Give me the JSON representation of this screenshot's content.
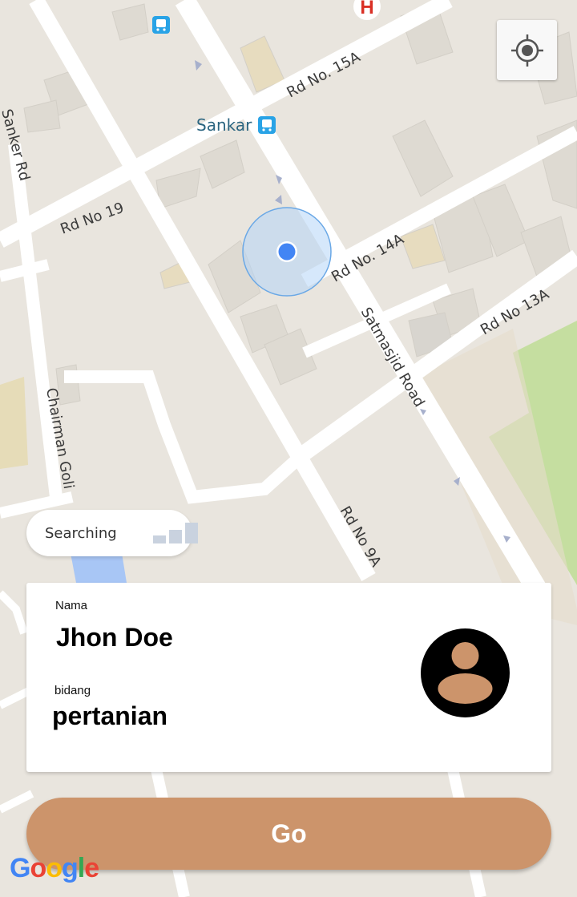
{
  "map": {
    "labels": {
      "road_15a": "Rd No. 15A",
      "sankar": "Sankar",
      "sanker_rd": "Sanker Rd",
      "road_19": "Rd No 19",
      "road_14a": "Rd No. 14A",
      "road_13a": "Rd No 13A",
      "satmasjid": "Satmasjid Road",
      "chairman_goli": "Chairman Goli",
      "road_9a": "Rd No 9A"
    },
    "hospital_glyph": "H",
    "google_logo": "Google"
  },
  "location_button": {
    "icon": "my-location-icon"
  },
  "status": {
    "label": "Searching",
    "icon": "signal-bars-icon"
  },
  "card": {
    "name_label": "Nama",
    "name_value": "Jhon Doe",
    "field_label": "bidang",
    "field_value": "pertanian",
    "avatar_icon": "person-avatar-icon"
  },
  "action": {
    "go_label": "Go"
  },
  "colors": {
    "accent": "#cc946b",
    "map_background": "#e9e5de",
    "road": "#ffffff",
    "park": "#c5dea0",
    "location_dot": "#4285f4",
    "hospital": "#d93025"
  }
}
